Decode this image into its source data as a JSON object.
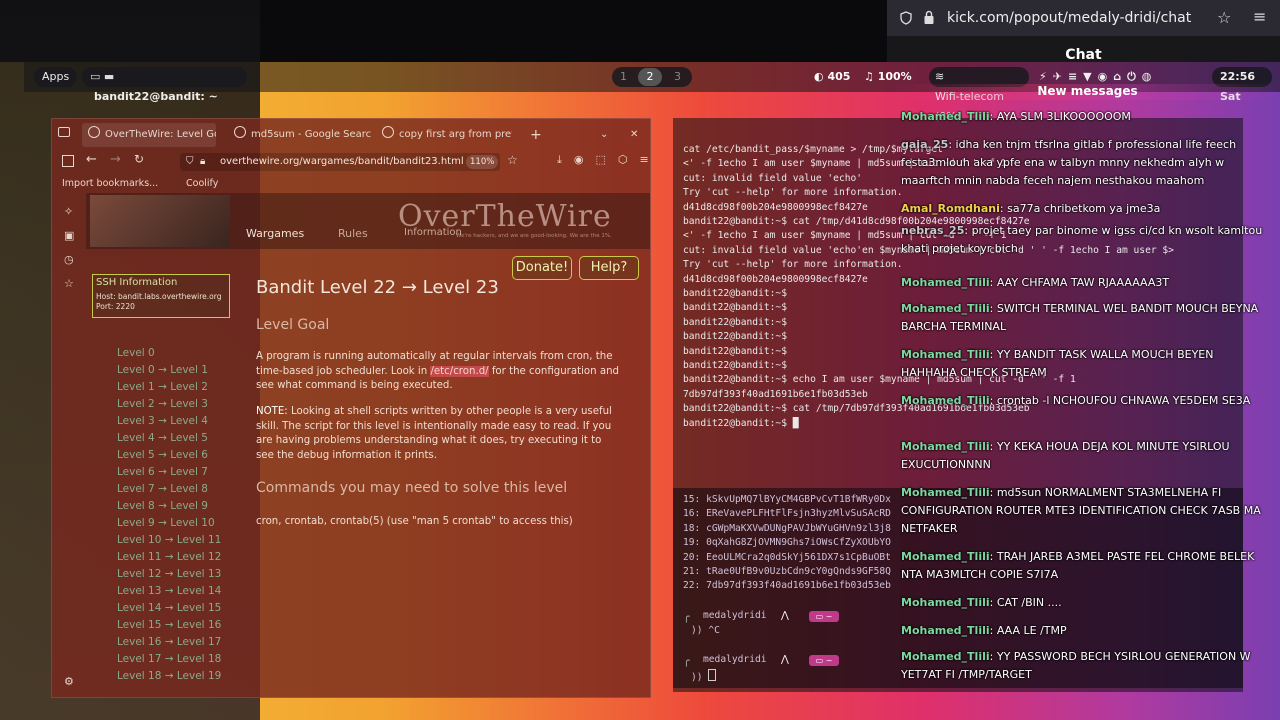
{
  "browser": {
    "url": "kick.com/popout/medaly-dridi/chat",
    "chat_label": "Chat"
  },
  "panel": {
    "apps": "Apps",
    "window_title": "bandit22@bandit: ~",
    "workspaces": [
      "1",
      "2",
      "3"
    ],
    "status": {
      "count": "405",
      "volume": "100%",
      "wifi": "Wifi-telecom (0%)",
      "clock": "22:56 Sat"
    }
  },
  "firefox": {
    "tabs": [
      {
        "label": "OverTheWire: Level Goal"
      },
      {
        "label": "md5sum - Google Search"
      },
      {
        "label": "copy first arg from previous"
      }
    ],
    "new_tab": "+",
    "close": "✕",
    "chevron": "⌄",
    "url": "overthewire.org/wargames/bandit/bandit23.html",
    "zoom": "110%",
    "bookmarks": [
      "Import bookmarks...",
      "Coolify"
    ],
    "header_menu": [
      "Wargames",
      "Rules",
      "Information"
    ],
    "logo_text": "OverTheWire",
    "logo_tagline": "We're hackers, and we are good-looking. We are the 1%.",
    "ssh_info": {
      "title": "SSH Information",
      "host": "Host: bandit.labs.overthewire.org",
      "port": "Port: 2220"
    },
    "nav_levels": [
      "Level 0",
      "Level 0 → Level 1",
      "Level 1 → Level 2",
      "Level 2 → Level 3",
      "Level 3 → Level 4",
      "Level 4 → Level 5",
      "Level 5 → Level 6",
      "Level 6 → Level 7",
      "Level 7 → Level 8",
      "Level 8 → Level 9",
      "Level 9 → Level 10",
      "Level 10 → Level 11",
      "Level 11 → Level 12",
      "Level 12 → Level 13",
      "Level 13 → Level 14",
      "Level 14 → Level 15",
      "Level 15 → Level 16",
      "Level 16 → Level 17",
      "Level 17 → Level 18",
      "Level 18 → Level 19"
    ],
    "donate": "Donate!",
    "help": "Help?",
    "page_title": "Bandit Level 22 → Level 23",
    "goal_heading": "Level Goal",
    "goal_text_1": "A program is running automatically at regular intervals from cron, the time-based job scheduler. Look in ",
    "goal_highlight": "/etc/cron.d/",
    "goal_text_2": " for the configuration and see what command is being executed.",
    "note_label": "NOTE:",
    "note_text": " Looking at shell scripts written by other people is a very useful skill. The script for this level is intentionally made easy to read. If you are having problems understanding what it does, try executing it to see the debug information it prints.",
    "commands_heading": "Commands you may need to solve this level",
    "commands_text": "cron, crontab, crontab(5) (use \"man 5 crontab\" to access this)"
  },
  "terminal": {
    "lines": [
      "cat /etc/bandit_pass/$myname > /tmp/$mytarget",
      "<' -f 1echo I am user $myname | md5sum | cut -d ' ' -f 1",
      "cut: invalid field value 'echo'",
      "Try 'cut --help' for more information.",
      "d41d8cd98f00b204e9800998ecf8427e",
      "bandit22@bandit:~$ cat /tmp/d41d8cd98f00b204e9800998ecf8427e",
      "<' -f 1echo I am user $myname | md5sum | cut -d ' ' -f 1",
      "cut: invalid field value 'echo'en $myname | md5sum | cut -d ' ' -f 1echo I am user $>",
      "Try 'cut --help' for more information.",
      "d41d8cd98f00b204e9800998ecf8427e",
      "bandit22@bandit:~$",
      "bandit22@bandit:~$",
      "bandit22@bandit:~$",
      "bandit22@bandit:~$",
      "bandit22@bandit:~$",
      "bandit22@bandit:~$",
      "bandit22@bandit:~$ echo I am user $myname | md5sum | cut -d ' ' -f 1",
      "7db97df393f40ad1691b6e1fb03d53eb",
      "bandit22@bandit:~$ cat /tmp/7db97df393f40ad1691b6e1fb03d53eb",
      "bandit22@bandit:~$ █"
    ],
    "passwords": [
      "15: kSkvUpMQ7lBYyCM4GBPvCvT1BfWRy0Dx",
      "16: EReVavePLFHtFlFsjn3hyzMlvSuSAcRD",
      "18: cGWpMaKXVwDUNgPAVJbWYuGHVn9zl3j8",
      "19: 0qXahG8ZjOVMN9Ghs7iOWsCfZyXOUbYO",
      "20: EeoULMCra2q0dSkYj561DX7s1CpBuOBt",
      "21: tRae0UfB9v0UzbCdn9cY0gQnds9GF58Q",
      "22: 7db97df393f40ad1691b6e1fb03d53eb"
    ],
    "prompt_user": "medalydridi",
    "prompt_arrow": "⋀",
    "prompt_dir": "~",
    "prompt_1_input": "^C",
    "prompt_2_input": ""
  },
  "chat": {
    "new_messages": "New messages",
    "messages": [
      {
        "user": "Mohamed_Tlili",
        "text": "AYA SLM 3LIKOOOOOOM",
        "color": "#7ed6a0"
      },
      {
        "user": "gaia_25",
        "text": "idha ken tnjm tfsrlna gitlab f professional life feech festa3mlouh aka ypfe ena w talbyn mnny nekhedm alyh w maarftch mnin nabda feceh najem nesthakou maahom",
        "color": "#c8c8c8"
      },
      {
        "user": "Amal_Romdhani",
        "text": "sa77a chribetkom ya jme3a",
        "color": "#f0d04a"
      },
      {
        "user": "nebras_25",
        "text": "projet taey par binome w igss ci/cd kn wsolt kamltou khati projet koyr bich",
        "color": "#c8c8c8"
      },
      {
        "user": "Mohamed_Tlili",
        "text": "AAY CHFAMA TAW RJAAAAAA3T",
        "color": "#7ed6a0"
      },
      {
        "user": "Mohamed_Tlili",
        "text": "SWITCH TERMINAL WEL BANDIT MOUCH BEYNA BARCHA TERMINAL",
        "color": "#7ed6a0"
      },
      {
        "user": "Mohamed_Tlili",
        "text": "YY BANDIT TASK WALLA MOUCH BEYEN HAHHAHA CHECK STREAM",
        "color": "#7ed6a0"
      },
      {
        "user": "Mohamed_Tlili",
        "text": "crontab -l NCHOUFOU CHNAWA YE5DEM SE3A",
        "color": "#7ed6a0"
      },
      {
        "user": "Mohamed_Tlili",
        "text": "YY KEKA HOUA DEJA KOL MINUTE YSIRLOU EXUCUTIONNNN",
        "color": "#7ed6a0"
      },
      {
        "user": "Mohamed_Tlili",
        "text": "md5sun NORMALMENT STA3MELNEHA FI CONFIGURATION ROUTER MTE3 IDENTIFICATION CHECK 7ASB MA NETFAKER",
        "color": "#7ed6a0"
      },
      {
        "user": "Mohamed_Tlili",
        "text": "TRAH JAREB A3MEL PASTE FEL CHROME BELEK NTA MA3MLTCH COPIE S7I7A",
        "color": "#7ed6a0"
      },
      {
        "user": "Mohamed_Tlili",
        "text": "CAT /BIN ....",
        "color": "#7ed6a0"
      },
      {
        "user": "Mohamed_Tlili",
        "text": "AAA LE /TMP",
        "color": "#7ed6a0"
      },
      {
        "user": "Mohamed_Tlili",
        "text": "YY PASSWORD BECH YSIRLOU GENERATION W YET7AT FI /TMP/TARGET",
        "color": "#7ed6a0"
      }
    ]
  }
}
